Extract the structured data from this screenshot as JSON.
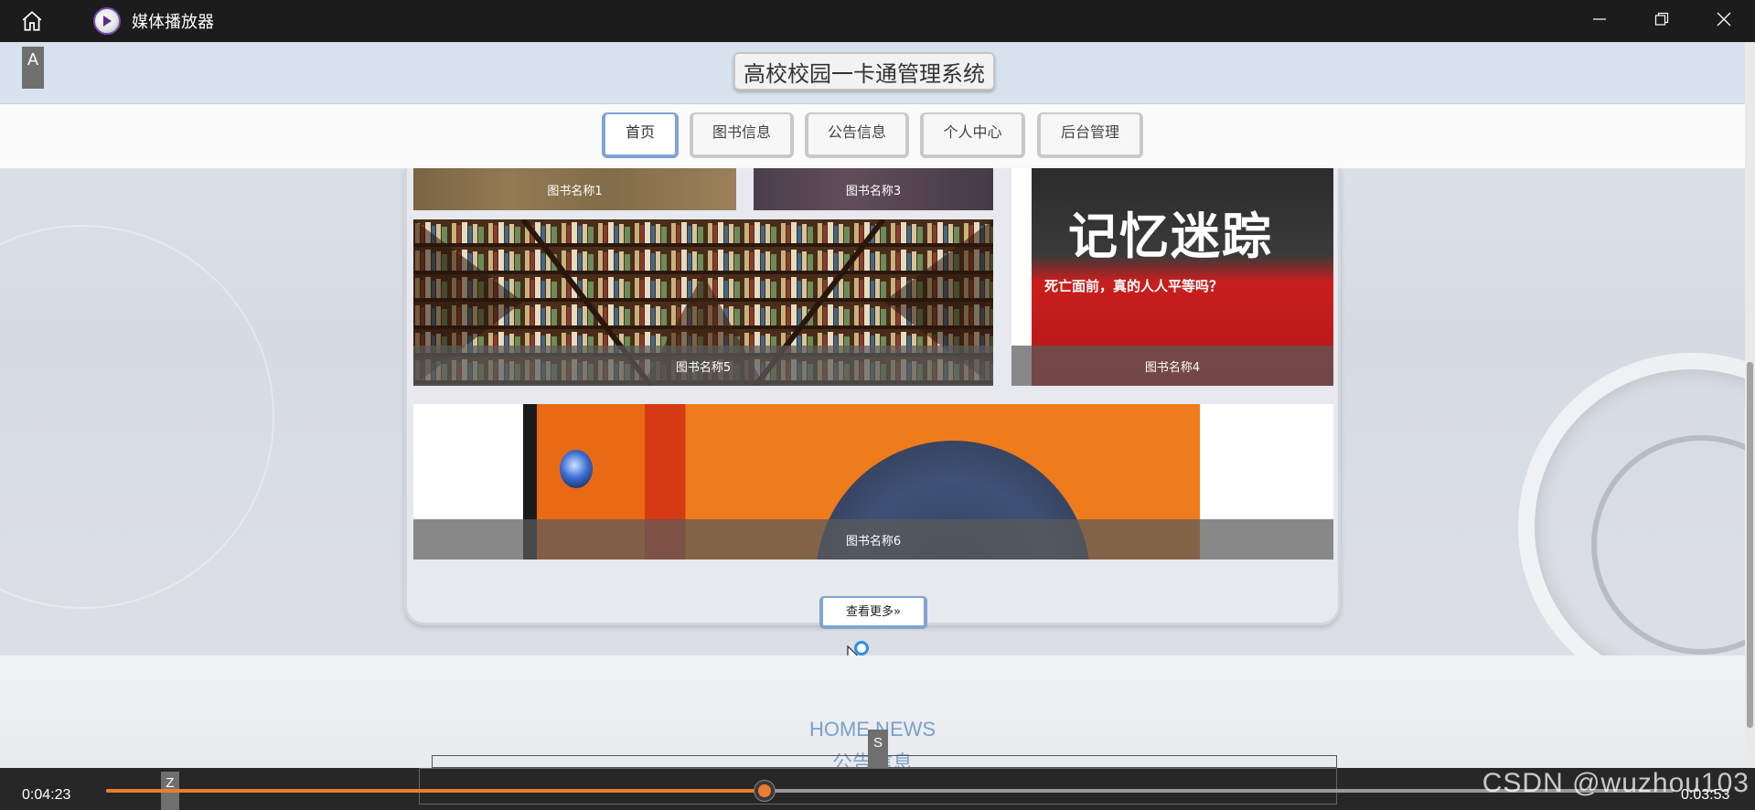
{
  "window": {
    "title": "媒体播放器",
    "icons": {
      "home": "home-icon",
      "app": "play-icon",
      "minimize": "minimize-icon",
      "maximize": "restore-icon",
      "close": "close-icon"
    }
  },
  "site": {
    "title": "高校校园一卡通管理系统",
    "a_tag": "A",
    "nav": [
      {
        "label": "首页",
        "active": true
      },
      {
        "label": "图书信息",
        "active": false
      },
      {
        "label": "公告信息",
        "active": false
      },
      {
        "label": "个人中心",
        "active": false
      },
      {
        "label": "后台管理",
        "active": false
      }
    ],
    "books": [
      {
        "caption": "图书名称1"
      },
      {
        "caption": "图书名称3"
      },
      {
        "caption": "图书名称5"
      },
      {
        "caption": "图书名称4",
        "cover_text": "记忆迷踪",
        "cover_subtitle": "死亡面前，真的人人平等吗？"
      },
      {
        "caption": "图书名称6"
      }
    ],
    "more_button": "查看更多»",
    "news": {
      "title_en": "HOME NEWS",
      "title_cn": "公告信息"
    },
    "s_tag": "S"
  },
  "player": {
    "current_time": "0:04:23",
    "remaining_time": "0:03:53",
    "progress_fraction": 0.42,
    "z_tag": "Z",
    "accent": "#f07c2d"
  },
  "watermark": "CSDN @wuzhou103"
}
